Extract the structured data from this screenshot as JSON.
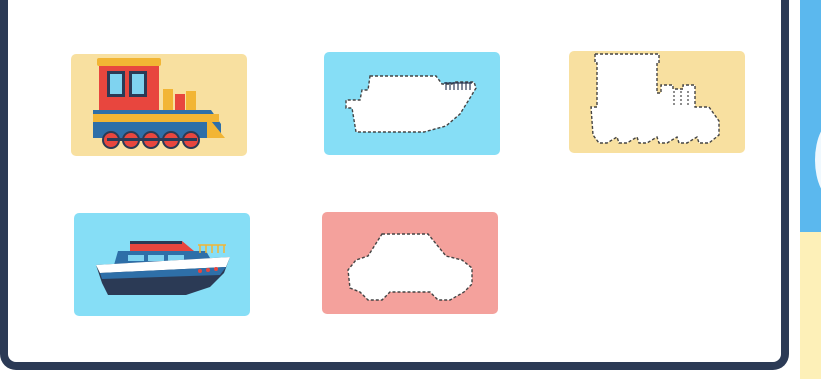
{
  "game": {
    "type": "shape-matching",
    "pieces": [
      {
        "id": "train",
        "kind": "picture",
        "color": "#f8e0a0"
      },
      {
        "id": "ship",
        "kind": "picture",
        "color": "#86def6"
      }
    ],
    "targets": [
      {
        "id": "ship",
        "kind": "silhouette",
        "color": "#86def6"
      },
      {
        "id": "train",
        "kind": "silhouette",
        "color": "#f8e0a0"
      },
      {
        "id": "car",
        "kind": "silhouette",
        "color": "#f4a19c"
      }
    ]
  },
  "colors": {
    "frame": "#2b3a55",
    "banner": "#fde27a",
    "bg_blue": "#5bb8ee",
    "bg_cream": "#fdf0b8"
  }
}
